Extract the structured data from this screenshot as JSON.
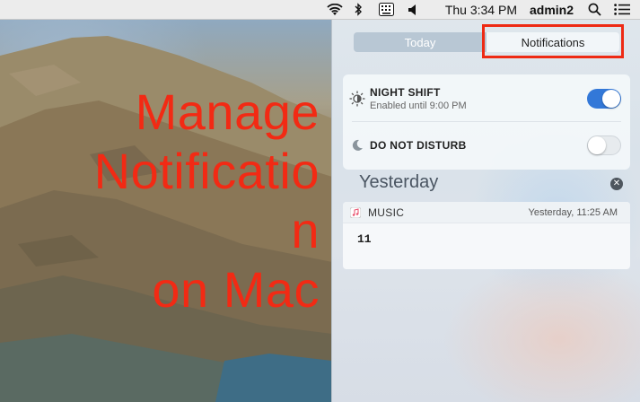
{
  "menubar": {
    "clock": "Thu 3:34 PM",
    "user": "admin2",
    "icons": [
      "wifi-icon",
      "bluetooth-icon",
      "keyboard-icon",
      "volume-icon",
      "search-icon",
      "notification-center-icon"
    ]
  },
  "overlay": {
    "line1": "Manage",
    "line2": "Notificatio",
    "line3": "n",
    "line4": "on Mac",
    "color": "#f22a14"
  },
  "notification_center": {
    "tabs": [
      {
        "label": "Today",
        "selected": false
      },
      {
        "label": "Notifications",
        "selected": true
      }
    ],
    "toggles": [
      {
        "title": "NIGHT SHIFT",
        "subtitle": "Enabled until 9:00 PM",
        "on": true,
        "icon": "night-shift-icon"
      },
      {
        "title": "DO NOT DISTURB",
        "on": false,
        "icon": "moon-icon"
      }
    ],
    "section_title": "Yesterday",
    "notification": {
      "app": "MUSIC",
      "time": "Yesterday, 11:25 AM",
      "body": "11"
    },
    "accent_color": "#3378d8",
    "highlight_color": "#ee2a14"
  }
}
